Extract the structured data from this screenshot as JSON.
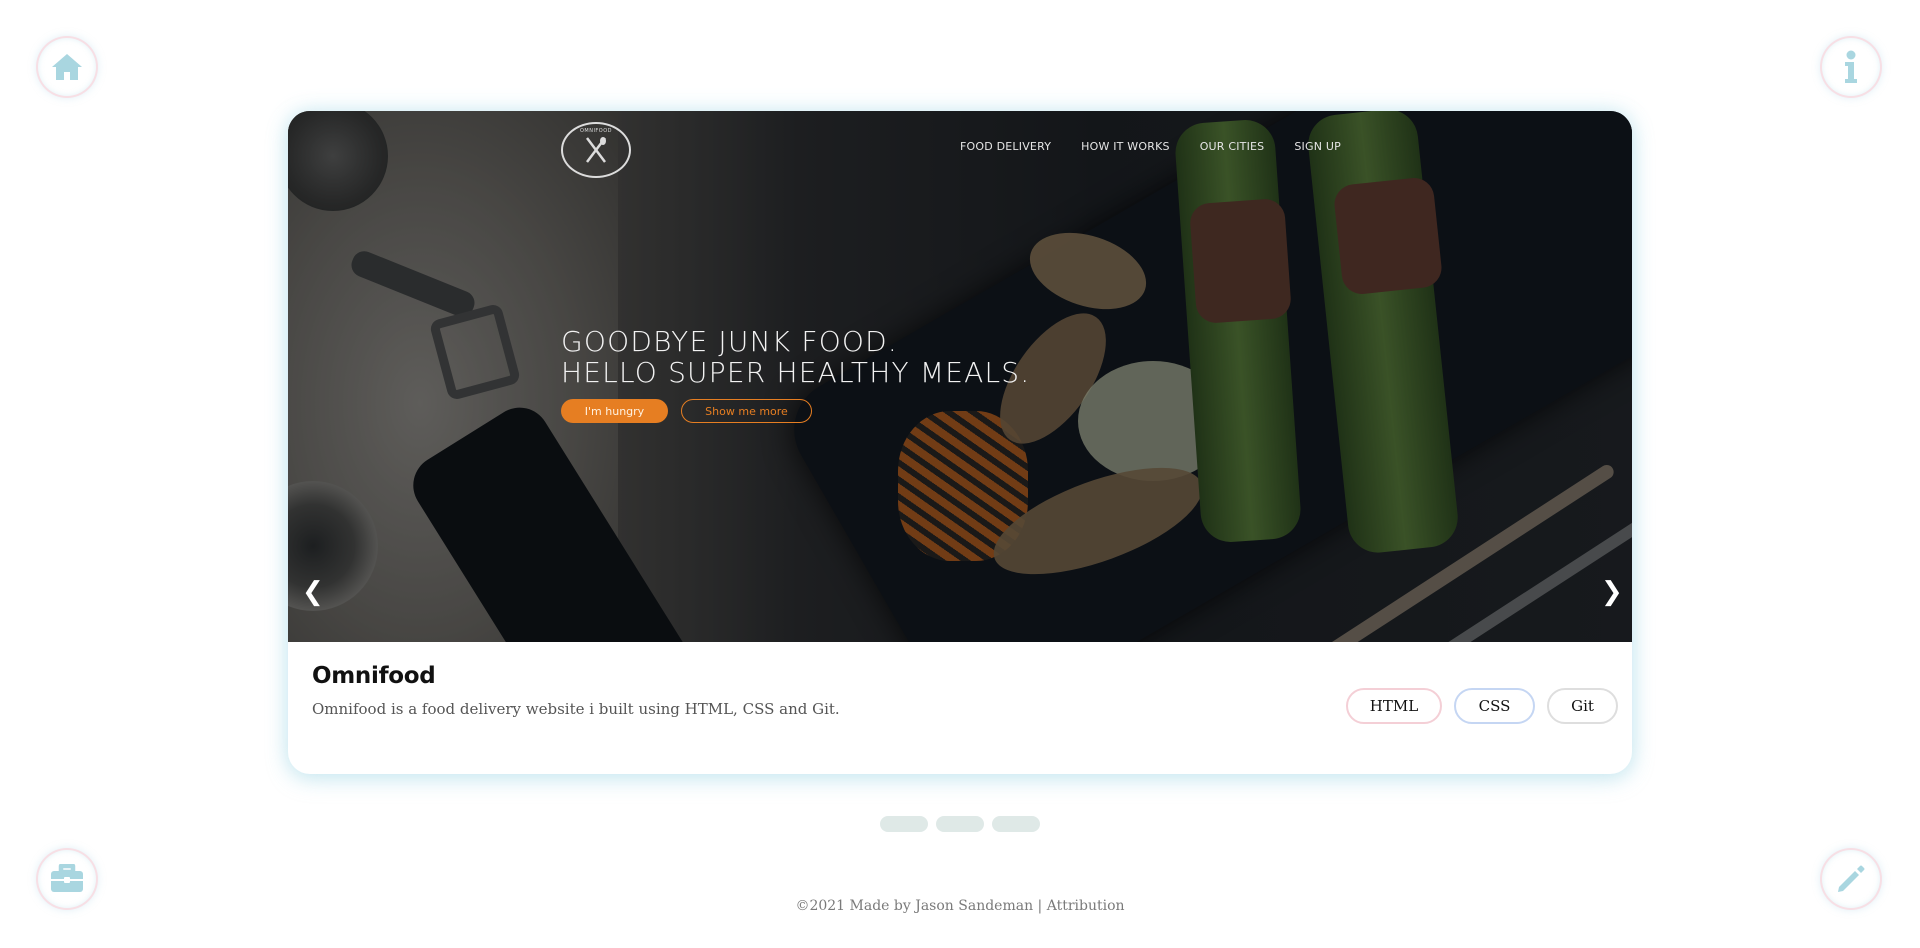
{
  "nav": {
    "home_icon": "home-icon",
    "info_icon": "info-icon",
    "work_icon": "briefcase-icon",
    "blog_icon": "pencil-icon"
  },
  "project": {
    "screenshot": {
      "logo_text": "OMNIFOOD",
      "nav_items": [
        "FOOD DELIVERY",
        "HOW IT WORKS",
        "OUR CITIES",
        "SIGN UP"
      ],
      "hero_line1": "GOODBYE JUNK FOOD.",
      "hero_line2": "HELLO SUPER HEALTHY MEALS.",
      "primary_button": "I'm hungry",
      "secondary_button": "Show me more"
    },
    "prev_arrow": "❮",
    "next_arrow": "❯",
    "title": "Omnifood",
    "description": "Omnifood is a food delivery website i built using HTML, CSS and Git.",
    "tags": [
      "HTML",
      "CSS",
      "Git"
    ]
  },
  "carousel": {
    "dot_count": 3
  },
  "footer": {
    "text": "©2021 Made by Jason Sandeman |",
    "link": "Attribution"
  },
  "colors": {
    "icon_color": "#a9d6e0",
    "accent_orange": "#e67e22",
    "dot_color": "#dfe9e7"
  }
}
